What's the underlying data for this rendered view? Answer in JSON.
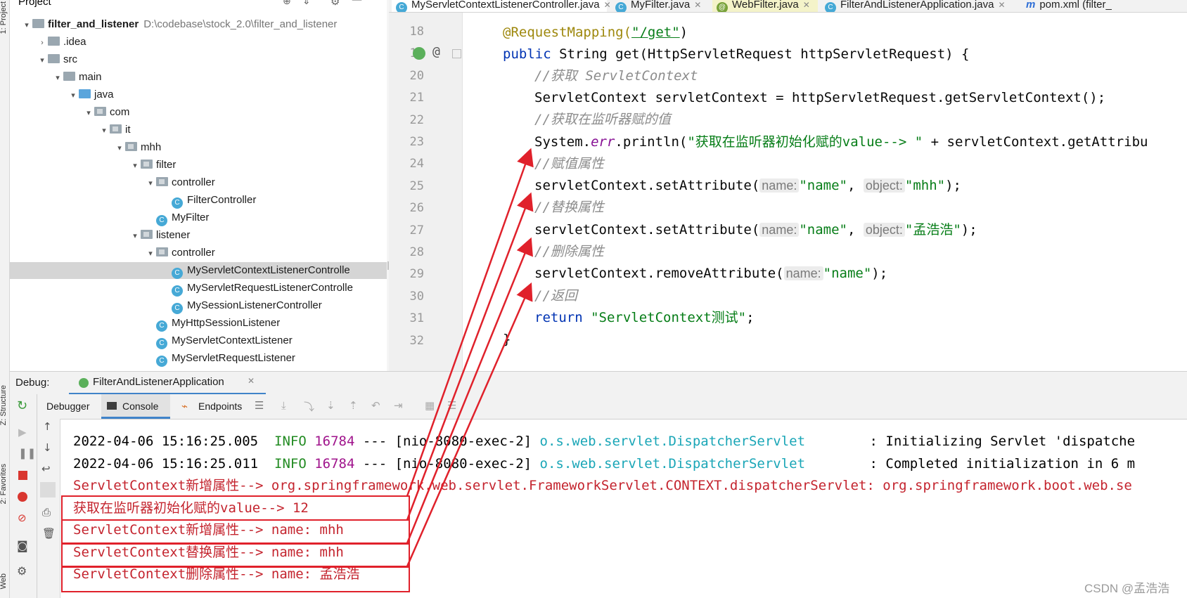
{
  "left_strip": {
    "project_label": "1: Project",
    "structure_label": "Z: Structure",
    "favorites_label": "2: Favorites",
    "web_label": "Web"
  },
  "project": {
    "header_label": "Project",
    "rows": [
      {
        "label": "filter_and_listener",
        "path": "D:\\codebase\\stock_2.0\\filter_and_listener",
        "arrow": "▾",
        "icon": "module"
      },
      {
        "label": ".idea",
        "arrow": "›",
        "icon": "folder"
      },
      {
        "label": "src",
        "arrow": "▾",
        "icon": "folder"
      },
      {
        "label": "main",
        "arrow": "▾",
        "icon": "folder"
      },
      {
        "label": "java",
        "arrow": "▾",
        "icon": "source-folder"
      },
      {
        "label": "com",
        "arrow": "▾",
        "icon": "package"
      },
      {
        "label": "it",
        "arrow": "▾",
        "icon": "package"
      },
      {
        "label": "mhh",
        "arrow": "▾",
        "icon": "package"
      },
      {
        "label": "filter",
        "arrow": "▾",
        "icon": "package"
      },
      {
        "label": "controller",
        "arrow": "▾",
        "icon": "package"
      },
      {
        "label": "FilterController",
        "arrow": "",
        "icon": "class"
      },
      {
        "label": "MyFilter",
        "arrow": "",
        "icon": "class"
      },
      {
        "label": "listener",
        "arrow": "▾",
        "icon": "package"
      },
      {
        "label": "controller",
        "arrow": "▾",
        "icon": "package"
      },
      {
        "label": "MyServletContextListenerControlle",
        "arrow": "",
        "icon": "class"
      },
      {
        "label": "MyServletRequestListenerControlle",
        "arrow": "",
        "icon": "class"
      },
      {
        "label": "MySessionListenerController",
        "arrow": "",
        "icon": "class"
      },
      {
        "label": "MyHttpSessionListener",
        "arrow": "",
        "icon": "class"
      },
      {
        "label": "MyServletContextListener",
        "arrow": "",
        "icon": "class"
      },
      {
        "label": "MyServletRequestListener",
        "arrow": "",
        "icon": "class"
      }
    ]
  },
  "tabs": [
    {
      "label": "MyServletContextListenerController.java",
      "icon": "C"
    },
    {
      "label": "MyFilter.java",
      "icon": "C"
    },
    {
      "label": "WebFilter.java",
      "icon": "@"
    },
    {
      "label": "FilterAndListenerApplication.java",
      "icon": "C"
    },
    {
      "label": "pom.xml (filter_",
      "icon": "m"
    }
  ],
  "editor": {
    "line_numbers": [
      "18",
      "19",
      "20",
      "21",
      "22",
      "23",
      "24",
      "25",
      "26",
      "27",
      "28",
      "29",
      "30",
      "31",
      "32"
    ],
    "line18": {
      "annotation": "@RequestMapping(",
      "path": "\"/get\"",
      "close": ")"
    },
    "line19": {
      "kw": "public",
      "rest": " String get(HttpServletRequest httpServletRequest) {"
    },
    "line20": "//获取 ServletContext",
    "line21": "ServletContext servletContext = httpServletRequest.getServletContext();",
    "line22": "//获取在监听器赋的值",
    "line23": {
      "a": "System.",
      "field": "err",
      "b": ".println(",
      "str": "\"获取在监听器初始化赋的value--> \"",
      "c": " + servletContext.getAttribu"
    },
    "line24": "//赋值属性",
    "line25": {
      "a": "servletContext.setAttribute(",
      "hint1": "name:",
      "str1": "\"name\"",
      "sep": ", ",
      "hint2": "object:",
      "str2": "\"mhh\"",
      "end": ");"
    },
    "line26": "//替换属性",
    "line27": {
      "a": "servletContext.setAttribute(",
      "hint1": "name:",
      "str1": "\"name\"",
      "sep": ", ",
      "hint2": "object:",
      "str2": "\"孟浩浩\"",
      "end": ");"
    },
    "line28": "//删除属性",
    "line29": {
      "a": "servletContext.removeAttribute(",
      "hint1": "name:",
      "str1": "\"name\"",
      "end": ");"
    },
    "line30": "//返回",
    "line31": {
      "kw": "return",
      "str": " \"ServletContext测试\"",
      "end": ";"
    },
    "line32": "}"
  },
  "debug": {
    "label": "Debug:",
    "session_tab": "FilterAndListenerApplication",
    "debugger_tab": "Debugger",
    "console_tab": "Console",
    "endpoints_tab": "Endpoints"
  },
  "console": {
    "log1": {
      "time": "2022-04-06 15:16:25.005",
      "level": "INFO",
      "pid": "16784",
      "thread": " --- [nio-8080-exec-2] ",
      "logger": "o.s.web.servlet.DispatcherServlet",
      "msg": "        : Initializing Servlet 'dispatche"
    },
    "log2": {
      "time": "2022-04-06 15:16:25.011",
      "level": "INFO",
      "pid": "16784",
      "thread": " --- [nio-8080-exec-2] ",
      "logger": "o.s.web.servlet.DispatcherServlet",
      "msg": "        : Completed initialization in 6 m"
    },
    "out1": "ServletContext新增属性--> org.springframework.web.servlet.FrameworkServlet.CONTEXT.dispatcherServlet: org.springframework.boot.web.se",
    "out2": "获取在监听器初始化赋的value--> 12",
    "out3": "ServletContext新增属性--> name: mhh",
    "out4": "ServletContext替换属性--> name: mhh",
    "out5": "ServletContext删除属性--> name: 孟浩浩"
  },
  "watermark": "CSDN @孟浩浩",
  "colors": {
    "annotation_red": "#e0212b",
    "keyword": "#0033b3",
    "string": "#067d17",
    "info": "#228b22",
    "stderr": "#c4242e"
  }
}
